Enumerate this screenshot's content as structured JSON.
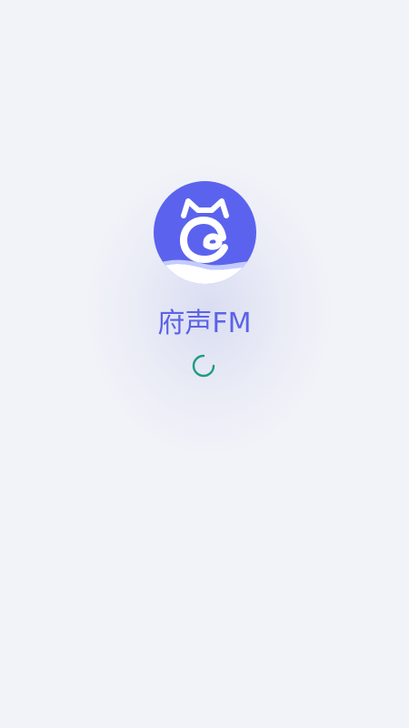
{
  "app": {
    "name": "府声FM",
    "logo_icon": "cat-c-logo-icon",
    "loading_icon": "loading-spinner-icon"
  },
  "colors": {
    "background": "#f2f3f8",
    "brand": "#5b63e6",
    "spinner": "#1f9b82"
  }
}
